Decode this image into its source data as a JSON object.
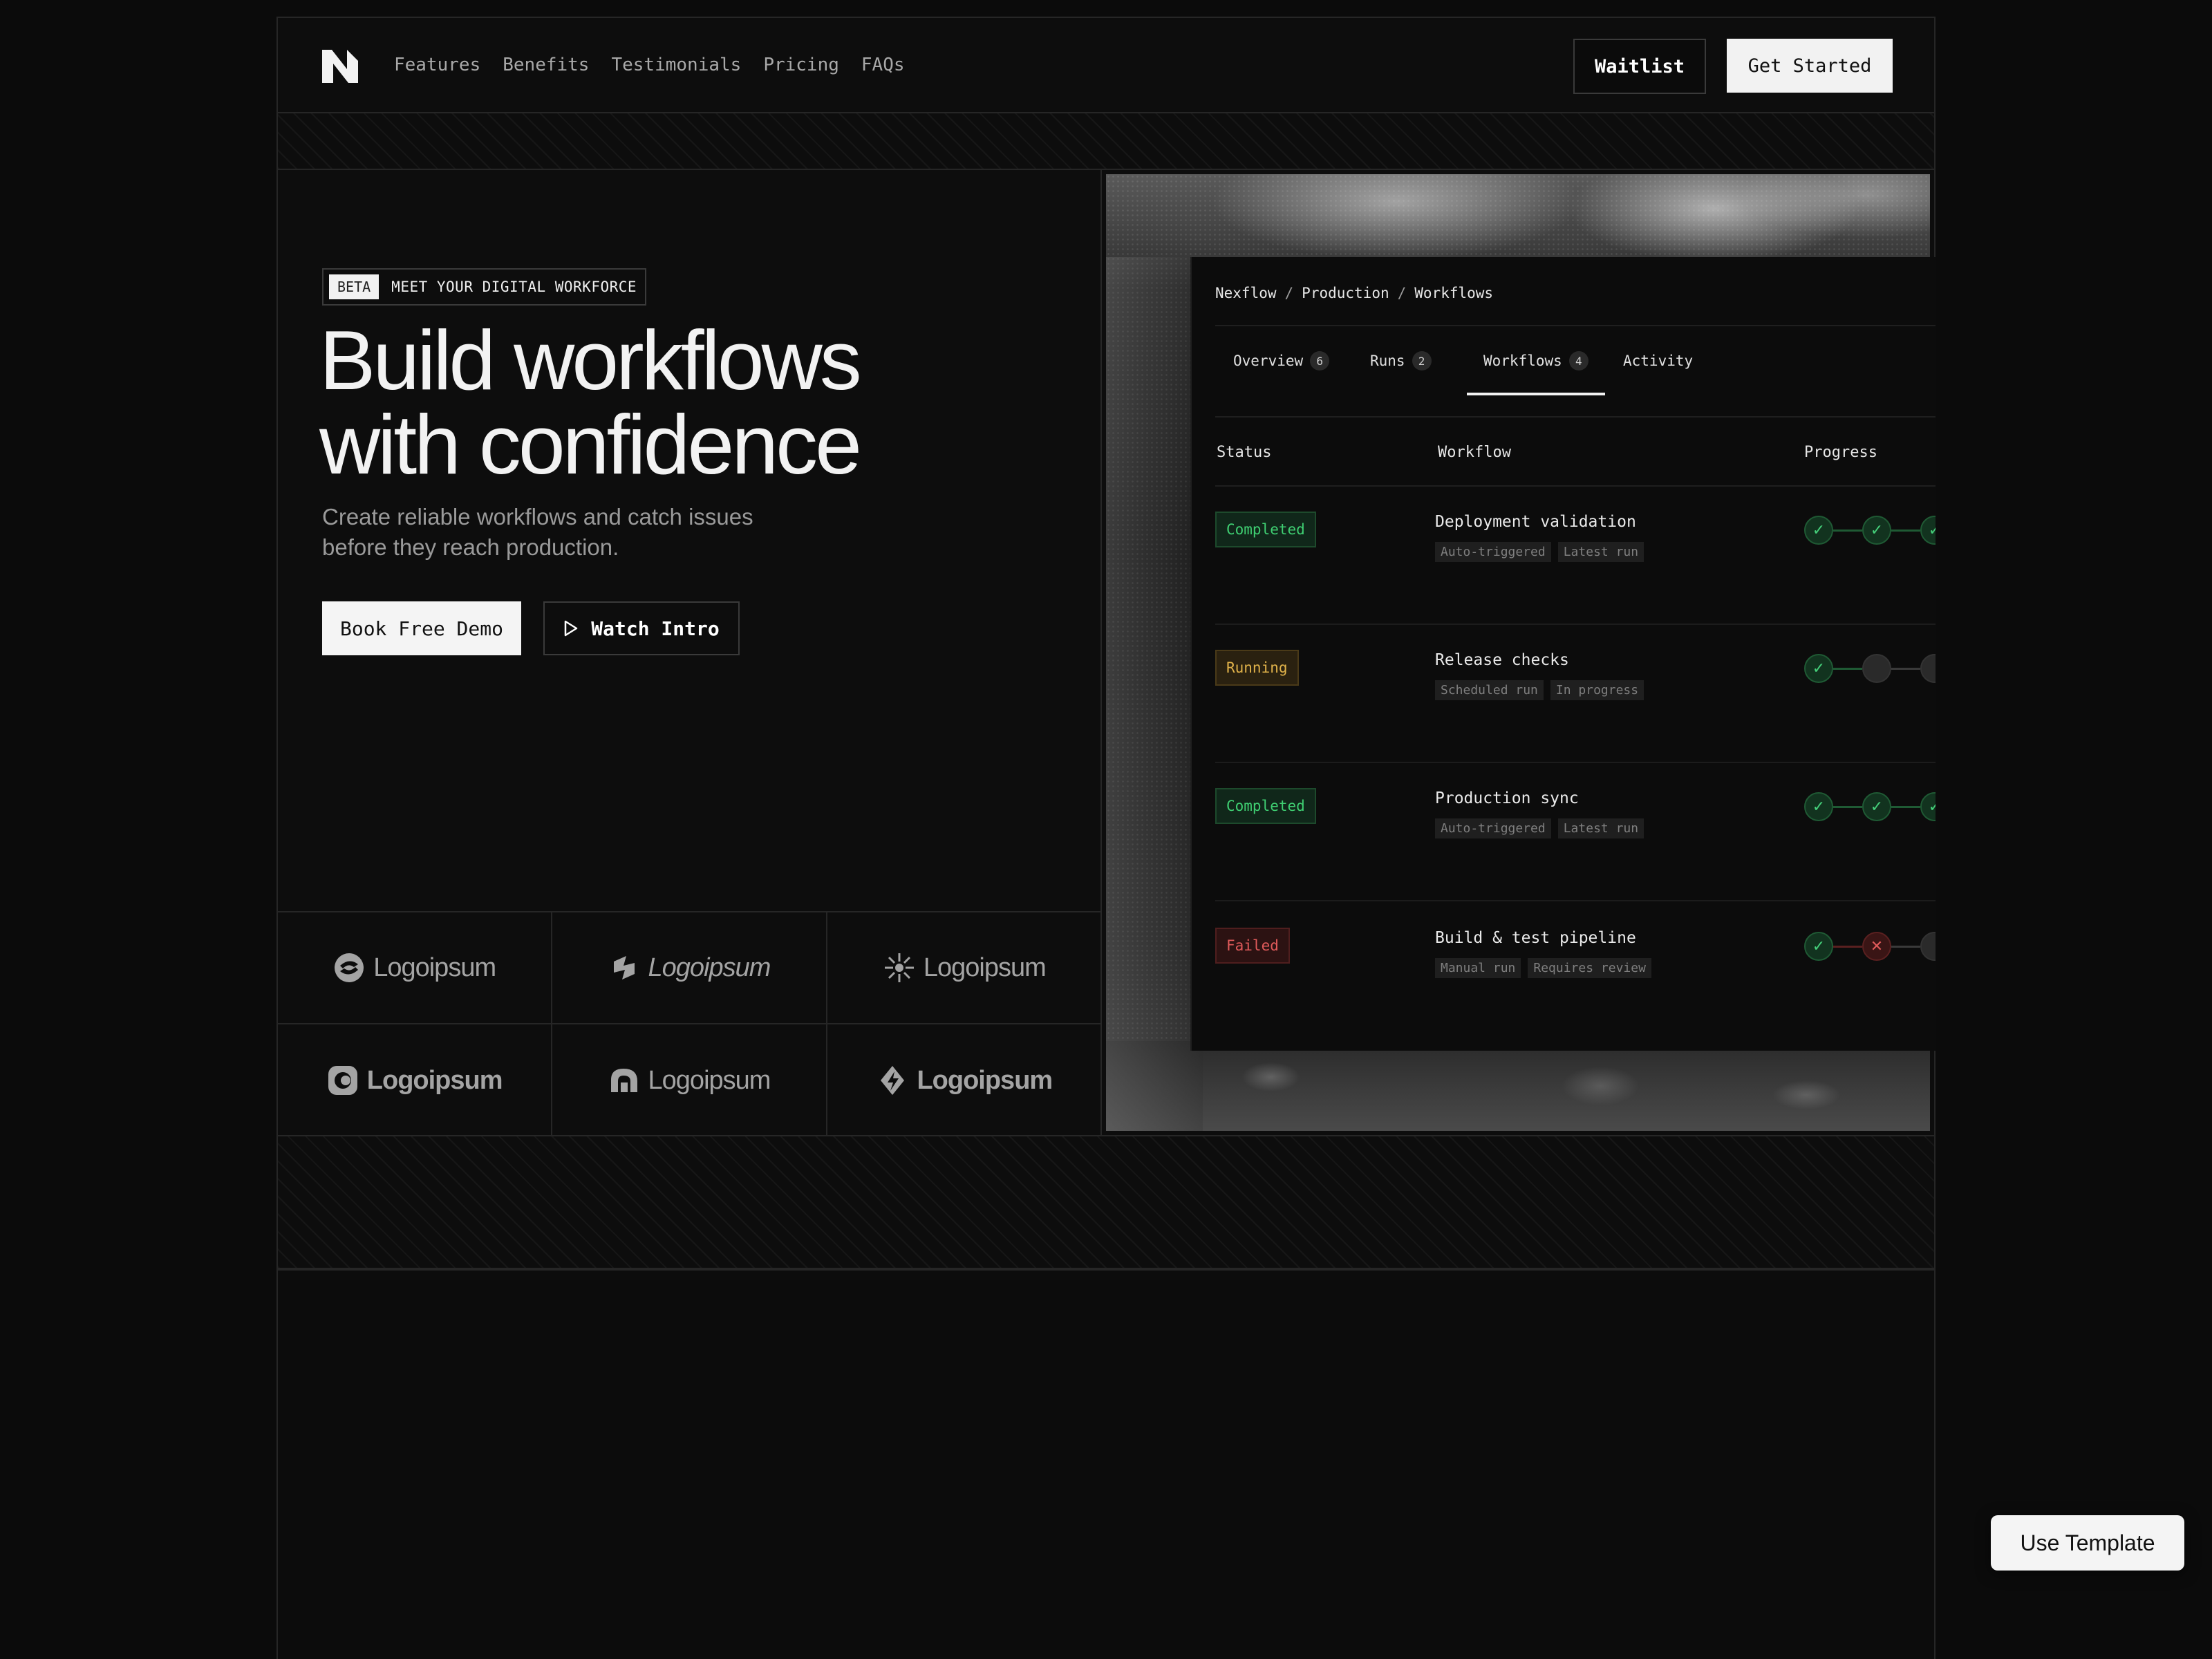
{
  "nav": {
    "links": [
      "Features",
      "Benefits",
      "Testimonials",
      "Pricing",
      "FAQs"
    ],
    "waitlist": "Waitlist",
    "get_started": "Get Started"
  },
  "hero": {
    "badge_tag": "BETA",
    "badge_text": "MEET YOUR DIGITAL WORKFORCE",
    "title_line1": "Build workflows",
    "title_line2": "with confidence",
    "subtitle_line1": "Create reliable workflows and catch issues",
    "subtitle_line2": "before they reach production.",
    "demo_button": "Book Free Demo",
    "intro_button": "Watch Intro"
  },
  "logos": [
    "Logoipsum",
    "Logoipsum",
    "Logoipsum",
    "Logoipsum",
    "Logoipsum",
    "Logoipsum"
  ],
  "app": {
    "breadcrumb": [
      "Nexflow",
      "Production",
      "Workflows"
    ],
    "tabs": [
      {
        "label": "Overview",
        "count": "6"
      },
      {
        "label": "Runs",
        "count": "2"
      },
      {
        "label": "Workflows",
        "count": "4"
      },
      {
        "label": "Activity",
        "count": ""
      }
    ],
    "active_tab": "Workflows",
    "columns": [
      "Status",
      "Workflow",
      "Progress"
    ],
    "rows": [
      {
        "status": "Completed",
        "name": "Deployment validation",
        "tags": [
          "Auto-triggered",
          "Latest run"
        ],
        "steps": [
          "ok",
          "ok",
          "ok"
        ]
      },
      {
        "status": "Running",
        "name": "Release checks",
        "tags": [
          "Scheduled run",
          "In progress"
        ],
        "steps": [
          "ok",
          "pending",
          "pending"
        ]
      },
      {
        "status": "Completed",
        "name": "Production sync",
        "tags": [
          "Auto-triggered",
          "Latest run"
        ],
        "steps": [
          "ok",
          "ok",
          "ok"
        ]
      },
      {
        "status": "Failed",
        "name": "Build & test pipeline",
        "tags": [
          "Manual run",
          "Requires review"
        ],
        "steps": [
          "ok",
          "fail",
          "pending"
        ]
      }
    ]
  },
  "use_template": "Use Template",
  "colors": {
    "background": "#0b0b0b",
    "completed": "#3fcf72",
    "running": "#e0b24a",
    "failed": "#e05a5a"
  }
}
